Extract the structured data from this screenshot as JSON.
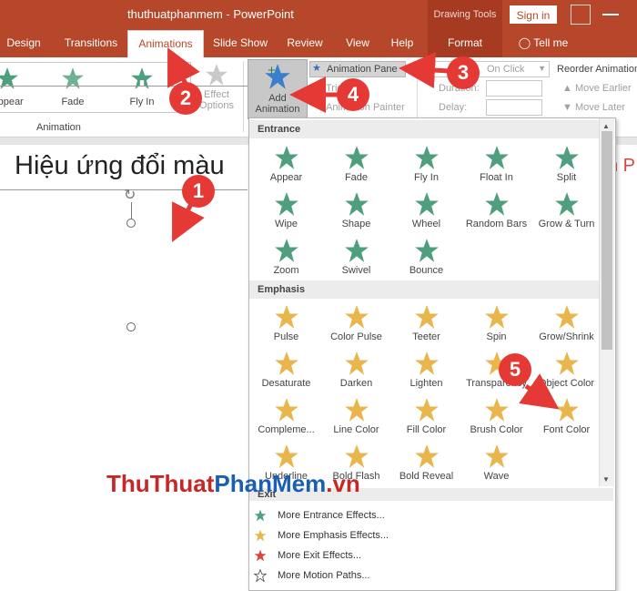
{
  "window": {
    "title": "thuthuatphanmem  -  PowerPoint",
    "context_tab_group": "Drawing Tools",
    "signin": "Sign in"
  },
  "tabs": [
    "Design",
    "Transitions",
    "Animations",
    "Slide Show",
    "Review",
    "View",
    "Help",
    "Format",
    "Tell me"
  ],
  "ribbon": {
    "animation_gallery": [
      "Appear",
      "Fade",
      "Fly In"
    ],
    "effect_options": [
      "Effect",
      "Options"
    ],
    "animation_group_label": "Animation",
    "add_animation": [
      "Add",
      "Animation"
    ],
    "animation_pane": "Animation Pane",
    "trigger": "Trigger",
    "animation_painter": "Animation Painter",
    "start": "On Click",
    "duration": "Duration:",
    "delay": "Delay:",
    "reorder": "Reorder Animation",
    "move_earlier": "Move Earlier",
    "move_later": "Move Later"
  },
  "slide": {
    "text": "Hiệu ứng đổi màu",
    "partial_right": "n P"
  },
  "gallery": {
    "entrance_title": "Entrance",
    "entrance": [
      "Appear",
      "Fade",
      "Fly In",
      "Float In",
      "Split",
      "Wipe",
      "Shape",
      "Wheel",
      "Random Bars",
      "Grow & Turn",
      "Zoom",
      "Swivel",
      "Bounce"
    ],
    "emphasis_title": "Emphasis",
    "emphasis": [
      "Pulse",
      "Color Pulse",
      "Teeter",
      "Spin",
      "Grow/Shrink",
      "Desaturate",
      "Darken",
      "Lighten",
      "Transparency",
      "Object Color",
      "Compleme...",
      "Line Color",
      "Fill Color",
      "Brush Color",
      "Font Color",
      "Underline",
      "Bold Flash",
      "Bold Reveal",
      "Wave"
    ],
    "exit_title": "Exit",
    "more": [
      "More Entrance Effects...",
      "More Emphasis Effects...",
      "More Exit Effects...",
      "More Motion Paths..."
    ]
  },
  "annotations": [
    "1",
    "2",
    "3",
    "4",
    "5"
  ],
  "watermark": {
    "part1": "ThuThuat",
    "part2": "PhanMem",
    "part3": ".vn"
  },
  "colors": {
    "accent": "#b7472a",
    "entrance_star": "#4f9e7e",
    "emphasis_star": "#e8b64c",
    "exit_star": "#d9473a",
    "arrow": "#e53935"
  }
}
